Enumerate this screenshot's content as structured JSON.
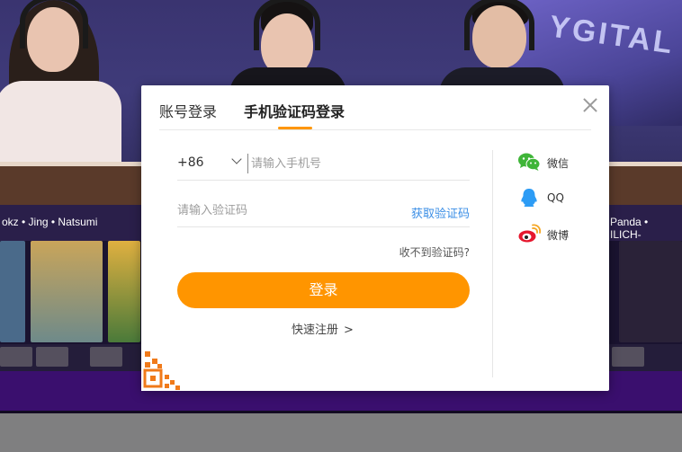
{
  "background": {
    "caster_names": "okz • Jing • Natsumi",
    "caster_names_right": "Panda • ILICH-",
    "neon_sign": "YGITAL"
  },
  "login_modal": {
    "tabs": [
      {
        "label": "账号登录",
        "active": false
      },
      {
        "label": "手机验证码登录",
        "active": true
      }
    ],
    "country_code": "+86",
    "phone_placeholder": "请输入手机号",
    "code_placeholder": "请输入验证码",
    "get_code_label": "获取验证码",
    "no_code_label": "收不到验证码?",
    "login_button": "登录",
    "register_label": "快速注册",
    "register_arrow": ">",
    "social": [
      {
        "icon": "wechat-icon",
        "label": "微信",
        "color": "#3fb538"
      },
      {
        "icon": "qq-icon",
        "label": "QQ",
        "color": "#2d9cf5"
      },
      {
        "icon": "weibo-icon",
        "label": "微博",
        "color": "#e6162d"
      }
    ],
    "accent_color": "#ff9500",
    "link_color": "#3a8ee6"
  }
}
